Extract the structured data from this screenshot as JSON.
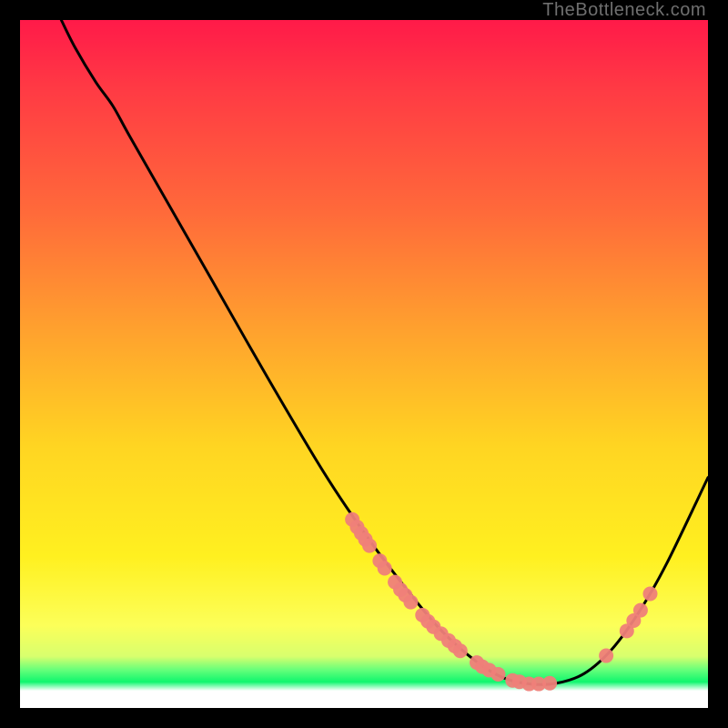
{
  "watermark": "TheBottleneck.com",
  "chart_data": {
    "type": "line",
    "title": "",
    "xlabel": "",
    "ylabel": "",
    "xlim": [
      0,
      100
    ],
    "ylim": [
      0,
      100
    ],
    "grid": false,
    "curve_points": [
      {
        "x": 6.0,
        "y": 100.0
      },
      {
        "x": 8.0,
        "y": 96.0
      },
      {
        "x": 11.0,
        "y": 91.0
      },
      {
        "x": 13.5,
        "y": 87.5
      },
      {
        "x": 16.0,
        "y": 83.0
      },
      {
        "x": 22.0,
        "y": 72.5
      },
      {
        "x": 28.0,
        "y": 62.0
      },
      {
        "x": 36.0,
        "y": 48.0
      },
      {
        "x": 44.0,
        "y": 34.5
      },
      {
        "x": 50.0,
        "y": 25.5
      },
      {
        "x": 56.0,
        "y": 17.5
      },
      {
        "x": 61.0,
        "y": 11.5
      },
      {
        "x": 66.0,
        "y": 7.0
      },
      {
        "x": 70.0,
        "y": 4.5
      },
      {
        "x": 74.0,
        "y": 3.5
      },
      {
        "x": 78.0,
        "y": 3.6
      },
      {
        "x": 82.0,
        "y": 5.0
      },
      {
        "x": 86.0,
        "y": 8.5
      },
      {
        "x": 90.0,
        "y": 14.0
      },
      {
        "x": 94.0,
        "y": 21.0
      },
      {
        "x": 100.0,
        "y": 33.5
      }
    ],
    "marker_points": [
      {
        "x": 48.3,
        "y": 27.4
      },
      {
        "x": 49.0,
        "y": 26.3
      },
      {
        "x": 49.6,
        "y": 25.4
      },
      {
        "x": 50.2,
        "y": 24.5
      },
      {
        "x": 50.8,
        "y": 23.6
      },
      {
        "x": 52.3,
        "y": 21.4
      },
      {
        "x": 53.0,
        "y": 20.3
      },
      {
        "x": 54.5,
        "y": 18.3
      },
      {
        "x": 55.3,
        "y": 17.2
      },
      {
        "x": 56.0,
        "y": 16.4
      },
      {
        "x": 56.8,
        "y": 15.4
      },
      {
        "x": 58.5,
        "y": 13.5
      },
      {
        "x": 59.3,
        "y": 12.6
      },
      {
        "x": 60.1,
        "y": 11.8
      },
      {
        "x": 61.2,
        "y": 10.8
      },
      {
        "x": 62.3,
        "y": 9.8
      },
      {
        "x": 63.2,
        "y": 9.0
      },
      {
        "x": 64.0,
        "y": 8.3
      },
      {
        "x": 66.4,
        "y": 6.6
      },
      {
        "x": 67.2,
        "y": 6.0
      },
      {
        "x": 68.2,
        "y": 5.5
      },
      {
        "x": 69.5,
        "y": 4.9
      },
      {
        "x": 71.6,
        "y": 4.0
      },
      {
        "x": 72.6,
        "y": 3.8
      },
      {
        "x": 74.0,
        "y": 3.5
      },
      {
        "x": 75.4,
        "y": 3.5
      },
      {
        "x": 77.0,
        "y": 3.6
      },
      {
        "x": 85.2,
        "y": 7.6
      },
      {
        "x": 88.2,
        "y": 11.2
      },
      {
        "x": 89.2,
        "y": 12.7
      },
      {
        "x": 90.2,
        "y": 14.2
      },
      {
        "x": 91.6,
        "y": 16.6
      }
    ],
    "marker_radius": 8,
    "annotations": []
  }
}
